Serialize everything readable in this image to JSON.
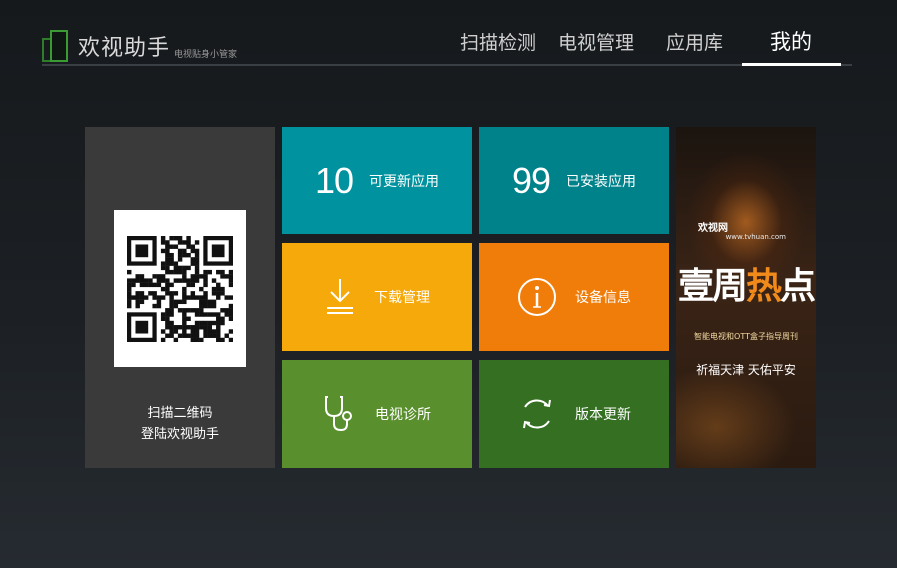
{
  "header": {
    "app_title": "欢视助手",
    "app_subtitle": "电视贴身小管家",
    "nav": [
      {
        "label": "扫描检测",
        "active": false
      },
      {
        "label": "电视管理",
        "active": false
      },
      {
        "label": "应用库",
        "active": false
      },
      {
        "label": "我的",
        "active": true
      }
    ]
  },
  "qr_panel": {
    "line1": "扫描二维码",
    "line2": "登陆欢视助手"
  },
  "tiles": {
    "updatable": {
      "count": "10",
      "label": "可更新应用",
      "color": "#00939f"
    },
    "installed": {
      "count": "99",
      "label": "已安装应用",
      "color": "#00828a"
    },
    "download": {
      "label": "下载管理",
      "icon": "download-icon",
      "color": "#f5a90a"
    },
    "device": {
      "label": "设备信息",
      "icon": "info-icon",
      "color": "#f07d0a"
    },
    "diagnosis": {
      "label": "电视诊所",
      "icon": "stethoscope-icon",
      "color": "#59902d"
    },
    "version": {
      "label": "版本更新",
      "icon": "refresh-icon",
      "color": "#356f22"
    }
  },
  "promo": {
    "brand": "欢视网",
    "url": "www.tvhuan.com",
    "title_part1": "壹周",
    "title_part2": "热",
    "title_part3": "点",
    "tagline": "智能电视和OTT盒子指导周刊",
    "slogan": "祈福天津 天佑平安"
  }
}
